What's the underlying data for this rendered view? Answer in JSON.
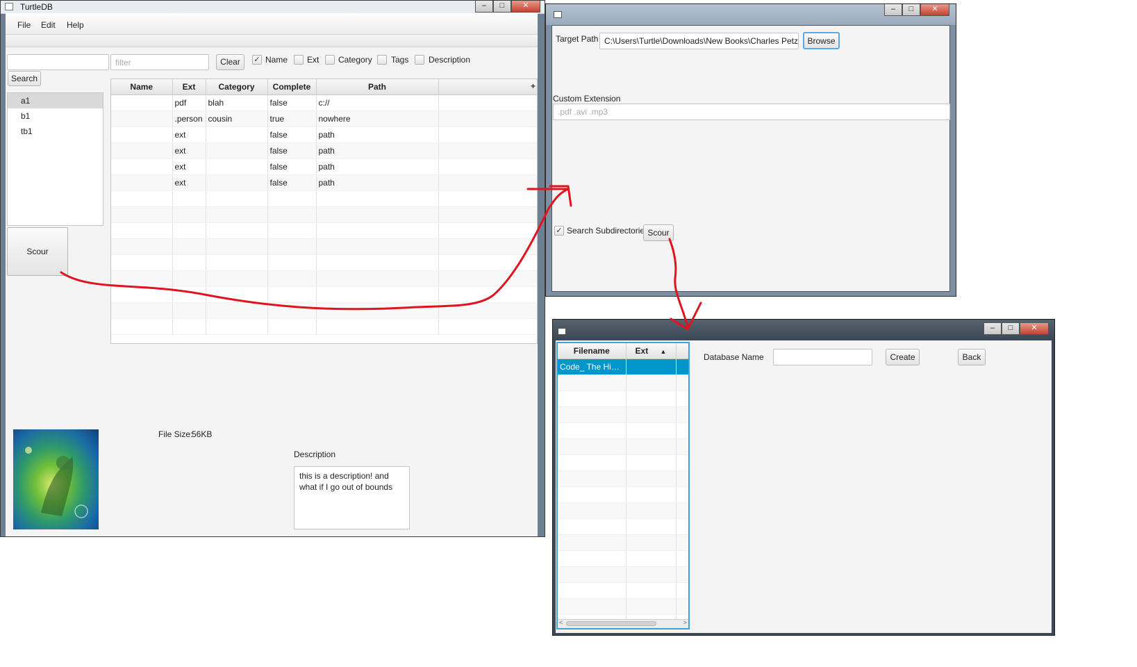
{
  "main_window": {
    "title": "TurtleDB",
    "menu": [
      "File",
      "Edit",
      "Help"
    ],
    "search_value": "",
    "filter_placeholder": "filter",
    "clear_label": "Clear",
    "search_label": "Search",
    "filters": [
      {
        "label": "Name",
        "checked": true
      },
      {
        "label": "Ext",
        "checked": false
      },
      {
        "label": "Category",
        "checked": false
      },
      {
        "label": "Tags",
        "checked": false
      },
      {
        "label": "Description",
        "checked": false
      }
    ],
    "databases": [
      "a1",
      "b1",
      "tb1"
    ],
    "selected_database": "a1",
    "scour_label": "Scour",
    "table": {
      "columns": [
        "Name",
        "Ext",
        "Category",
        "Complete",
        "Path"
      ],
      "menu_button": "+",
      "rows": [
        [
          "",
          "pdf",
          "blah",
          "false",
          "c://"
        ],
        [
          "",
          ".person",
          "cousin",
          "true",
          "nowhere"
        ],
        [
          "",
          "ext",
          "",
          "false",
          "path"
        ],
        [
          "",
          "ext",
          "",
          "false",
          "path"
        ],
        [
          "",
          "ext",
          "",
          "false",
          "path"
        ],
        [
          "",
          "ext",
          "",
          "false",
          "path"
        ]
      ]
    },
    "file_size_label": "File Size:",
    "file_size_value": "56KB",
    "description_label": "Description",
    "description_text": "this is a description! and what if I go out of bounds"
  },
  "scour_window": {
    "target_path_label": "Target Path",
    "target_path_value": "C:\\Users\\Turtle\\Downloads\\New Books\\Charles Petzol",
    "browse_label": "Browse",
    "custom_extension_label": "Custom Extension",
    "custom_extension_placeholder": ".pdf .avi .mp3",
    "search_subdirectories_label": "Search Subdirectories",
    "search_subdirectories_checked": true,
    "scour_label": "Scour"
  },
  "create_window": {
    "table": {
      "columns": [
        "Filename",
        "Ext"
      ],
      "sort_indicator": "▲",
      "rows": [
        [
          "Code_ The Hidd...",
          ""
        ]
      ]
    },
    "database_name_label": "Database Name",
    "database_name_value": "",
    "create_label": "Create",
    "back_label": "Back"
  },
  "annotation_color": "#e0141e",
  "window_buttons": {
    "minimize": "–",
    "maximize": "□",
    "close": "✕"
  }
}
